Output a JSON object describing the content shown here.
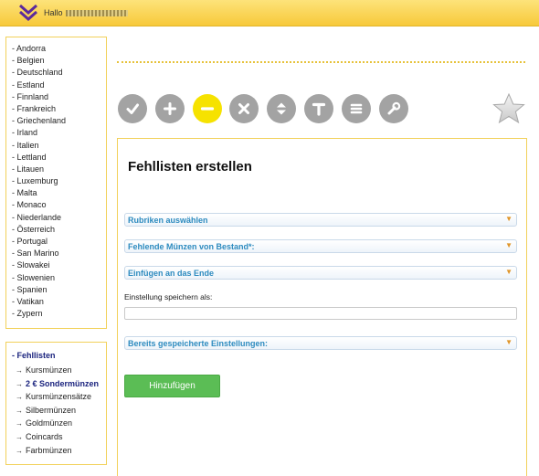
{
  "header": {
    "greeting": "Hallo",
    "logo_icon": "double-chevron-down-icon"
  },
  "countries": [
    "- Andorra",
    "- Belgien",
    "- Deutschland",
    "- Estland",
    "- Finnland",
    "- Frankreich",
    "- Griechenland",
    "- Irland",
    "- Italien",
    "- Lettland",
    "- Litauen",
    "- Luxemburg",
    "- Malta",
    "- Monaco",
    "- Niederlande",
    "- Österreich",
    "- Portugal",
    "- San Marino",
    "- Slowakei",
    "- Slowenien",
    "- Spanien",
    "- Vatikan",
    "- Zypern"
  ],
  "categories": {
    "heading": "- Fehllisten",
    "items": [
      {
        "label": "Kursmünzen",
        "active": false
      },
      {
        "label": "2 € Sondermünzen",
        "active": true
      },
      {
        "label": "Kursmünzensätze",
        "active": false
      },
      {
        "label": "Silbermünzen",
        "active": false
      },
      {
        "label": "Goldmünzen",
        "active": false
      },
      {
        "label": "Coincards",
        "active": false
      },
      {
        "label": "Farbmünzen",
        "active": false
      }
    ]
  },
  "toolbar": {
    "buttons": [
      {
        "icon": "check-icon",
        "active": false
      },
      {
        "icon": "plus-icon",
        "active": false
      },
      {
        "icon": "minus-icon",
        "active": true
      },
      {
        "icon": "close-icon",
        "active": false
      },
      {
        "icon": "sort-icon",
        "active": false
      },
      {
        "icon": "text-icon",
        "active": false
      },
      {
        "icon": "list-icon",
        "active": false
      },
      {
        "icon": "wrench-icon",
        "active": false
      }
    ],
    "favorite_icon": "star-icon"
  },
  "form": {
    "title": "Fehllisten erstellen",
    "select_rubriken": "Rubriken auswählen",
    "select_fehlende": "Fehlende Münzen von Bestand*:",
    "select_einfuegen": "Einfügen an das Ende",
    "save_label": "Einstellung speichern als:",
    "save_value": "",
    "select_saved": "Bereits gespeicherte Einstellungen:",
    "submit_label": "Hinzufügen"
  },
  "colors": {
    "accent_yellow": "#f7c93a",
    "select_text": "#2d8bbf",
    "button_green": "#5bbd55",
    "active_tool": "#f6e200",
    "nav_active": "#1a237e"
  }
}
